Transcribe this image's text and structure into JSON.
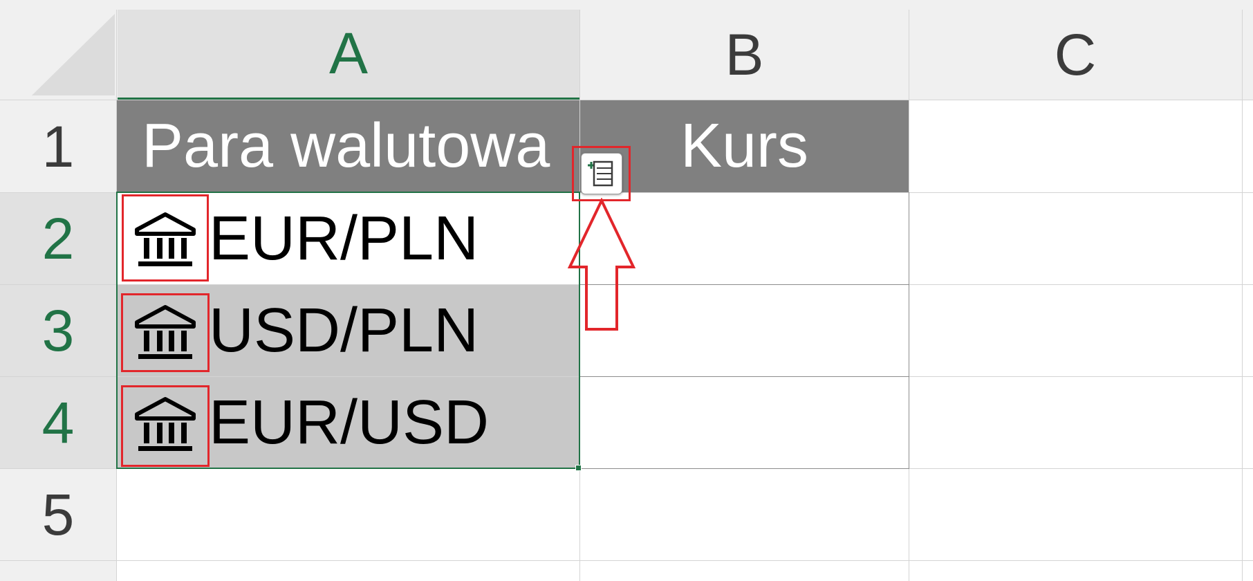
{
  "sheet": {
    "columns": [
      "A",
      "B",
      "C"
    ],
    "rows": [
      "1",
      "2",
      "3",
      "4",
      "5"
    ],
    "selected_column": "A",
    "selected_rows": [
      "2",
      "3",
      "4"
    ]
  },
  "table": {
    "header_a": "Para walutowa",
    "header_b": "Kurs",
    "rows": [
      {
        "label": "EUR/PLN",
        "icon": "bank-icon"
      },
      {
        "label": "USD/PLN",
        "icon": "bank-icon"
      },
      {
        "label": "EUR/USD",
        "icon": "bank-icon"
      }
    ]
  },
  "colors": {
    "accent": "#217346",
    "header_fill": "#808080",
    "selection_fill": "#c8c8c8",
    "annotation": "#e2262b"
  },
  "insert_data_button": {
    "icon": "insert-data-icon"
  }
}
